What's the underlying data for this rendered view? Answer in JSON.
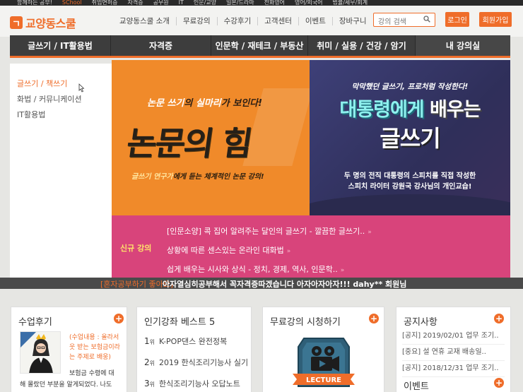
{
  "top_strip": [
    "함께하는 공부!",
    "SChool",
    "취업면허증",
    "자격증",
    "공무원",
    "IT",
    "인문/교양",
    "일본/드라마",
    "전화영어",
    "영어/외국어",
    "법률/세무/회계"
  ],
  "header": {
    "logo_text": "교양동스쿨",
    "nav": [
      "교양동스쿨 소개",
      "무료강의",
      "수강후기",
      "고객센터",
      "이벤트",
      "장바구니"
    ],
    "search_placeholder": "강의 검색",
    "login_label": "로그인",
    "join_label": "회원가입"
  },
  "categories": [
    "글쓰기 / IT활용법",
    "자격증",
    "인문학 / 재테크 / 부동산",
    "취미 / 실용 / 건강 / 암기",
    "내 강의실"
  ],
  "submenu": [
    "글쓰기 / 책쓰기",
    "화법 / 커뮤니케이션",
    "IT활용법"
  ],
  "banner_left": {
    "tag_pre": "논문 쓰기",
    "tag_mid": "의 ",
    "tag_hl": "실마리",
    "tag_post": "가 보인다!",
    "title": "논문의 힘",
    "sub_hl": "글쓰기 연구가",
    "sub_post": "에게 듣는 체계적인 논문 강의!"
  },
  "banner_right": {
    "top": "막막했던 글쓰기, 프로처럼 작성한다!",
    "title1_a": "대통령에게 ",
    "title1_b": "배우는",
    "title2": "글쓰기",
    "desc1": "두 명의 전직 대통령의 스피치를 직접 작성한",
    "desc2": "스피치 라이터 강원국 강사님의 개인교습!"
  },
  "new_courses": {
    "label": "신규 강의",
    "items": [
      "[인문소양] 콕 집어 알려주는 달인의 글쓰기 - 깔끔한 글쓰기..",
      "상황에 따른 센스있는 온라인 대화법",
      "쉽게 배우는 시사와 상식 - 정치, 경제, 역사, 인문학.."
    ],
    "arrow": "»"
  },
  "ticker": {
    "pre": "[혼자공부하기 좋아요]",
    "main": "아자열심히공부해서 꼭자격증따겠습니다 아자아자아자!!! dahy** 회원님"
  },
  "card_reviews": {
    "title": "수업후기",
    "review_label": "(수업내용 : 올라서 웃 받는 보험금이라는 주제로 배웅)",
    "body_1": "보험금 수령에 대",
    "body_2": "해 몰랐던 부분을 알게되었다. 나도"
  },
  "card_best": {
    "title": "인기강좌 베스트 5",
    "unit": "위",
    "items": [
      {
        "rank": "1",
        "name": "K-POP댄스 완전정복"
      },
      {
        "rank": "2",
        "name": "2019 한식조리기능사 실기"
      },
      {
        "rank": "3",
        "name": "한식조리기능사 오답노트"
      }
    ]
  },
  "card_free": {
    "title": "무료강의 시청하기",
    "badge_text": "LECTURE"
  },
  "card_notice": {
    "title": "공지사항",
    "items": [
      "[공지] 2019/02/01 업무 조기..",
      "[중요] 설 연휴 교재 배송일..",
      "[공지] 2018/12/31 업무 조기.."
    ],
    "event_title": "이벤트"
  },
  "plus": "+",
  "colors": {
    "accent": "#ef6d2a",
    "dark_bar": "#3d3d3d",
    "pink": "#d8447b",
    "navy": "#3a3a6a"
  }
}
